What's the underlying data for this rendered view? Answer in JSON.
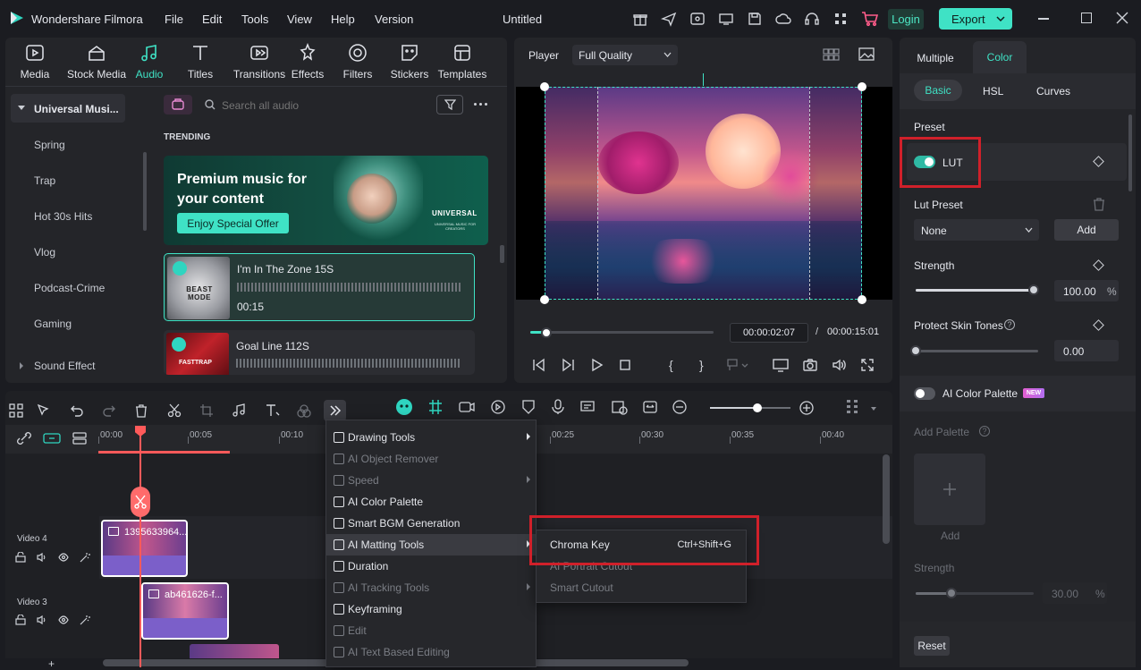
{
  "app": {
    "name": "Wondershare Filmora",
    "project_title": "Untitled"
  },
  "menu": [
    "File",
    "Edit",
    "Tools",
    "View",
    "Help",
    "Version"
  ],
  "header": {
    "login_label": "Login",
    "export_label": "Export"
  },
  "toolbar": {
    "items": [
      {
        "label": "Media",
        "icon": "media-icon"
      },
      {
        "label": "Stock Media",
        "icon": "stock-media-icon"
      },
      {
        "label": "Audio",
        "icon": "audio-icon"
      },
      {
        "label": "Titles",
        "icon": "titles-icon"
      },
      {
        "label": "Transitions",
        "icon": "transitions-icon"
      },
      {
        "label": "Effects",
        "icon": "effects-icon"
      },
      {
        "label": "Filters",
        "icon": "filters-icon"
      },
      {
        "label": "Stickers",
        "icon": "stickers-icon"
      },
      {
        "label": "Templates",
        "icon": "templates-icon"
      }
    ],
    "active": "Audio"
  },
  "library": {
    "root": "Universal Musi...",
    "items": [
      "Spring",
      "Trap",
      "Hot 30s Hits",
      "Vlog",
      "Podcast-Crime",
      "Gaming"
    ],
    "sound_effect": "Sound Effect"
  },
  "audio": {
    "search_placeholder": "Search all audio",
    "trending_label": "TRENDING",
    "banner_title_1": "Premium music for",
    "banner_title_2": "your content",
    "banner_cta": "Enjoy Special Offer",
    "banner_brand": "UNIVERSAL",
    "banner_brand_sub": "UNIVERSAL MUSIC FOR CREATORS",
    "tracks": [
      {
        "title": "I'm In The Zone 15S",
        "duration": "00:15",
        "thumb_text": "BEAST MODE"
      },
      {
        "title": "Goal Line 112S",
        "duration": "",
        "thumb_text": "FASTTRAP"
      }
    ]
  },
  "player": {
    "label": "Player",
    "quality": "Full Quality",
    "current_time": "00:00:02:07",
    "separator": "/",
    "total_time": "00:00:15:01",
    "progress": 0.09
  },
  "right_panel": {
    "tabs": [
      "Multiple",
      "Color"
    ],
    "active_tab": "Color",
    "subtabs": [
      "Basic",
      "HSL",
      "Curves"
    ],
    "active_subtab": "Basic",
    "preset_label": "Preset",
    "lut_label": "LUT",
    "lut_enabled": true,
    "lut_preset_label": "Lut Preset",
    "lut_preset_value": "None",
    "add_label": "Add",
    "strength_label": "Strength",
    "strength_value": "100.00",
    "strength_unit": "%",
    "strength_level": 1.0,
    "protect_label": "Protect Skin Tones",
    "protect_value": "0.00",
    "protect_level": 0.0,
    "ai_palette_label": "AI Color Palette",
    "new_badge": "NEW",
    "add_palette_label": "Add Palette",
    "add_palette_btn": "Add",
    "strength2_label": "Strength",
    "strength2_value": "30.00",
    "strength2_unit": "%",
    "strength2_level": 0.3,
    "reset_label": "Reset"
  },
  "timeline": {
    "ruler": [
      "00:00",
      "00:05",
      "00:10",
      "00:25",
      "00:30",
      "00:35",
      "00:40"
    ],
    "tracks": [
      {
        "name": "Video 4",
        "clip": "1395633964..."
      },
      {
        "name": "Video 3",
        "clip": "ab461626-f..."
      }
    ],
    "zoom_level": 0.6
  },
  "context_menu": {
    "items": [
      {
        "label": "Drawing Tools",
        "enabled": true,
        "submenu": true
      },
      {
        "label": "AI Object Remover",
        "enabled": false,
        "submenu": false
      },
      {
        "label": "Speed",
        "enabled": false,
        "submenu": true
      },
      {
        "label": "AI Color Palette",
        "enabled": true,
        "submenu": false
      },
      {
        "label": "Smart BGM Generation",
        "enabled": true,
        "submenu": false
      },
      {
        "label": "AI Matting Tools",
        "enabled": true,
        "submenu": true
      },
      {
        "label": "Duration",
        "enabled": true,
        "submenu": false
      },
      {
        "label": "AI Tracking Tools",
        "enabled": false,
        "submenu": true
      },
      {
        "label": "Keyframing",
        "enabled": true,
        "submenu": false
      },
      {
        "label": "Edit",
        "enabled": false,
        "submenu": false
      },
      {
        "label": "AI Text Based Editing",
        "enabled": false,
        "submenu": false
      }
    ],
    "submenu": [
      {
        "label": "Chroma Key",
        "shortcut": "Ctrl+Shift+G",
        "enabled": true
      },
      {
        "label": "AI Portrait Cutout",
        "shortcut": "",
        "enabled": false
      },
      {
        "label": "Smart Cutout",
        "shortcut": "",
        "enabled": false
      }
    ]
  },
  "colors": {
    "accent": "#3ee0c0",
    "highlight_box": "#d0202a",
    "clip": "#7b5fc9",
    "playhead": "#ff5a5a"
  }
}
